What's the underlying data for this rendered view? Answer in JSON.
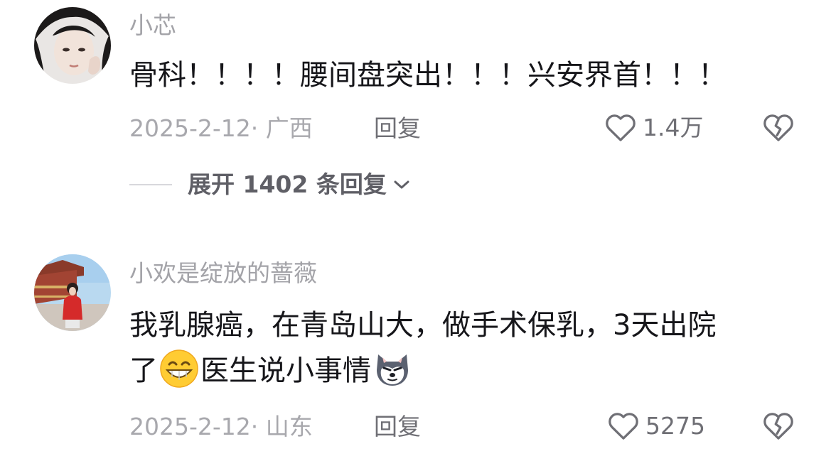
{
  "comments": [
    {
      "username": "小芯",
      "content_lines": [
        "骨科！！！！腰间盘突出！！！兴安界首！！！"
      ],
      "date_location": "2025-2-12· 广西",
      "reply_label": "回复",
      "likes": "1.4万",
      "expand_label": "展开 1402 条回复"
    },
    {
      "username": "小欢是绽放的蔷薇",
      "content_line1": "我乳腺癌，在青岛山大，做手术保乳，3天出院",
      "content_line2_a": "了",
      "content_line2_b": "医生说小事情",
      "emojis": [
        "grinning-face-icon",
        "husky-dog-icon"
      ],
      "date_location": "2025-2-12· 山东",
      "reply_label": "回复",
      "likes": "5275"
    }
  ],
  "icons": {
    "like": "heart-outline-icon",
    "dislike": "broken-heart-icon",
    "expand": "chevron-down-icon"
  },
  "colors": {
    "username": "#a3a3a8",
    "content": "#16161a",
    "meta": "#a8a8ad",
    "action": "#6f6f75"
  }
}
